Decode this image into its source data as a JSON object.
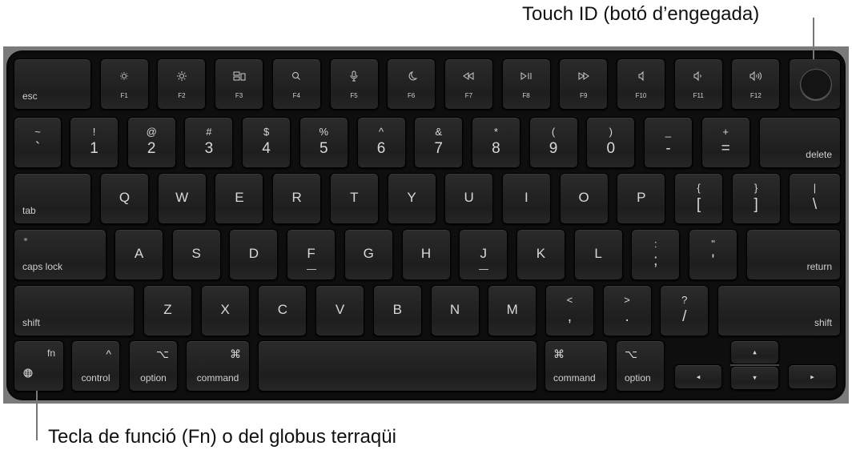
{
  "callouts": {
    "touch_id": "Touch ID (botó d’engegada)",
    "fn_key": "Tecla de funció (Fn) o del globus terraqüi"
  },
  "colors": {
    "keyboard": "#0e0e0e",
    "key": "#252525",
    "frame": "#7a7a7a",
    "legend": "#d8d8d8"
  },
  "rows": [
    [
      {
        "mod": "esc",
        "align": "left"
      },
      {
        "fkey": "F1",
        "icon": "brightness-down-icon"
      },
      {
        "fkey": "F2",
        "icon": "brightness-up-icon"
      },
      {
        "fkey": "F3",
        "icon": "mission-control-icon"
      },
      {
        "fkey": "F4",
        "icon": "search-icon"
      },
      {
        "fkey": "F5",
        "icon": "microphone-icon"
      },
      {
        "fkey": "F6",
        "icon": "moon-icon"
      },
      {
        "fkey": "F7",
        "icon": "rewind-icon"
      },
      {
        "fkey": "F8",
        "icon": "play-pause-icon"
      },
      {
        "fkey": "F9",
        "icon": "fast-forward-icon"
      },
      {
        "fkey": "F10",
        "icon": "mute-icon"
      },
      {
        "fkey": "F11",
        "icon": "volume-down-icon"
      },
      {
        "fkey": "F12",
        "icon": "volume-up-icon"
      },
      {
        "touchid": true,
        "icon": "touch-id-icon"
      }
    ],
    [
      {
        "top": "~",
        "bot": "`"
      },
      {
        "top": "!",
        "bot": "1"
      },
      {
        "top": "@",
        "bot": "2"
      },
      {
        "top": "#",
        "bot": "3"
      },
      {
        "top": "$",
        "bot": "4"
      },
      {
        "top": "%",
        "bot": "5"
      },
      {
        "top": "^",
        "bot": "6"
      },
      {
        "top": "&",
        "bot": "7"
      },
      {
        "top": "*",
        "bot": "8"
      },
      {
        "top": "(",
        "bot": "9"
      },
      {
        "top": ")",
        "bot": "0"
      },
      {
        "top": "_",
        "bot": "-"
      },
      {
        "top": "+",
        "bot": "="
      },
      {
        "mod": "delete",
        "align": "right"
      }
    ],
    [
      {
        "mod": "tab",
        "align": "left"
      },
      {
        "letter": "Q"
      },
      {
        "letter": "W"
      },
      {
        "letter": "E"
      },
      {
        "letter": "R"
      },
      {
        "letter": "T"
      },
      {
        "letter": "Y"
      },
      {
        "letter": "U"
      },
      {
        "letter": "I"
      },
      {
        "letter": "O"
      },
      {
        "letter": "P"
      },
      {
        "top": "{",
        "bot": "["
      },
      {
        "top": "}",
        "bot": "]"
      },
      {
        "top": "|",
        "bot": "\\"
      }
    ],
    [
      {
        "mod": "caps lock",
        "align": "left",
        "dot": true
      },
      {
        "letter": "A"
      },
      {
        "letter": "S"
      },
      {
        "letter": "D"
      },
      {
        "letter": "F",
        "bump": true
      },
      {
        "letter": "G"
      },
      {
        "letter": "H"
      },
      {
        "letter": "J",
        "bump": true
      },
      {
        "letter": "K"
      },
      {
        "letter": "L"
      },
      {
        "top": ":",
        "bot": ";"
      },
      {
        "top": "\"",
        "bot": "'"
      },
      {
        "mod": "return",
        "align": "right"
      }
    ],
    [
      {
        "mod": "shift",
        "align": "left"
      },
      {
        "letter": "Z"
      },
      {
        "letter": "X"
      },
      {
        "letter": "C"
      },
      {
        "letter": "V"
      },
      {
        "letter": "B"
      },
      {
        "letter": "N"
      },
      {
        "letter": "M"
      },
      {
        "top": "<",
        "bot": ","
      },
      {
        "top": ">",
        "bot": "."
      },
      {
        "top": "?",
        "bot": "/"
      },
      {
        "mod": "shift",
        "align": "right"
      }
    ],
    [
      {
        "mod": "fn",
        "align": "right-top",
        "icon": "globe-icon"
      },
      {
        "mod": "control",
        "align": "center",
        "sym": "^"
      },
      {
        "mod": "option",
        "align": "center",
        "sym": "⌥"
      },
      {
        "mod": "command",
        "align": "center",
        "sym": "⌘"
      },
      {
        "space": true
      },
      {
        "mod": "command",
        "align": "left",
        "sym": "⌘"
      },
      {
        "mod": "option",
        "align": "left",
        "sym": "⌥"
      },
      {
        "arrow": "◂",
        "name": "left-arrow"
      },
      {
        "arrow": "▴",
        "name": "up-arrow"
      },
      {
        "arrow": "▾",
        "name": "down-arrow"
      },
      {
        "arrow": "▸",
        "name": "right-arrow"
      }
    ]
  ]
}
